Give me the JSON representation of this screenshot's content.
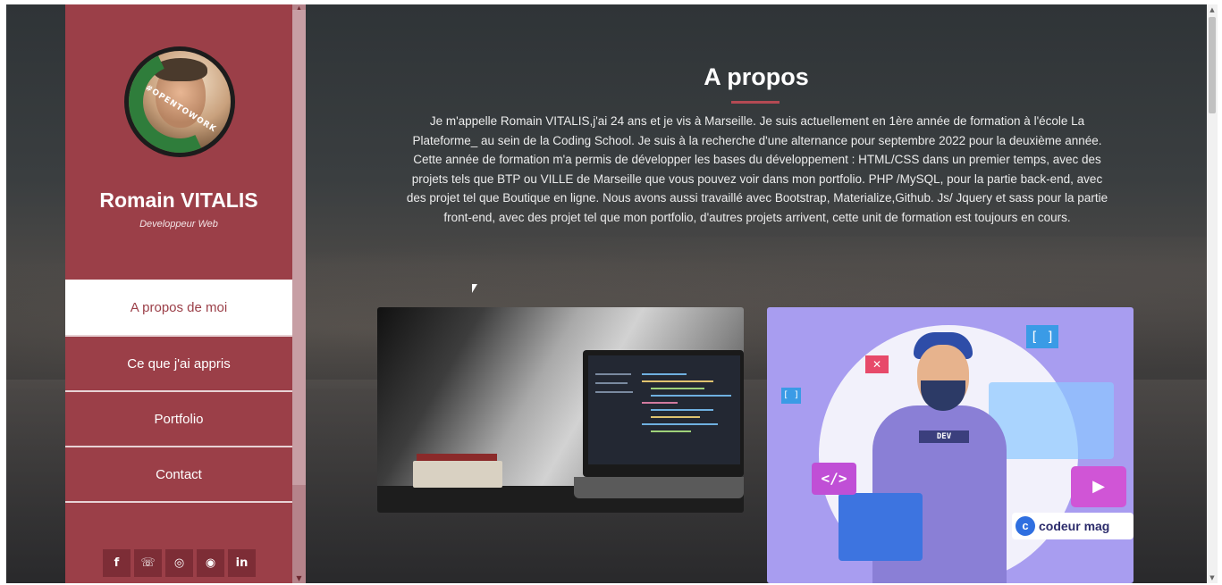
{
  "profile": {
    "name": "Romain VITALIS",
    "role": "Developpeur Web",
    "avatar_badge": "#OPENTOWORK"
  },
  "nav": {
    "items": [
      {
        "label": "A propos de moi",
        "active": true
      },
      {
        "label": "Ce que j'ai appris",
        "active": false
      },
      {
        "label": "Portfolio",
        "active": false
      },
      {
        "label": "Contact",
        "active": false
      }
    ]
  },
  "socials": {
    "facebook": "f",
    "phone": "☏",
    "instagram": "◎",
    "github": "◉",
    "linkedin": "in"
  },
  "about": {
    "title": "A propos",
    "paragraph": "Je m'appelle Romain VITALIS,j'ai 24 ans et je vis à Marseille. Je suis actuellement en 1ère année de formation à l'école La Plateforme_ au sein de la Coding School. Je suis à la recherche d'une alternance pour septembre 2022 pour la deuxième année. Cette année de formation m'a permis de développer les bases du développement : HTML/CSS dans un premier temps, avec des projets tels que BTP ou VILLE de Marseille que vous pouvez voir dans mon portfolio. PHP /MySQL, pour la partie back-end, avec des projet tel que Boutique en ligne. Nous avons aussi travaillé avec Bootstrap, Materialize,Github. Js/ Jquery et sass pour la partie front-end, avec des projet tel que mon portfolio, d'autres projets arrivent, cette unit de formation est toujours en cours."
  },
  "illustration": {
    "dev_tag": "DEV",
    "code_symbol": "</>",
    "bracket": "[ ]",
    "bracket_small": "[ ]",
    "close_symbol": "✕",
    "play_symbol": "▶",
    "logo_letter": "c",
    "logo_text": "codeur mag"
  },
  "colors": {
    "sidebar": "#9b3f48",
    "accent_line": "#b44a53",
    "social_button": "#7d2d36"
  }
}
